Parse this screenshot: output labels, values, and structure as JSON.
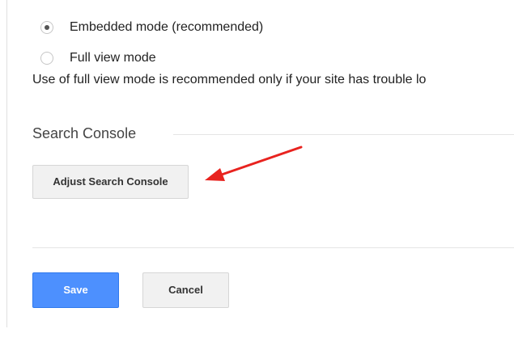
{
  "display_mode": {
    "options": [
      {
        "label": "Embedded mode (recommended)",
        "selected": true
      },
      {
        "label": "Full view mode",
        "selected": false
      }
    ],
    "help_text": "Use of full view mode is recommended only if your site has trouble lo"
  },
  "search_console": {
    "title": "Search Console",
    "adjust_button_label": "Adjust Search Console"
  },
  "annotation": {
    "arrow_color": "#e8231f"
  },
  "footer": {
    "save_label": "Save",
    "cancel_label": "Cancel"
  },
  "colors": {
    "primary_button": "#4d90fe",
    "secondary_button": "#f1f1f1"
  }
}
